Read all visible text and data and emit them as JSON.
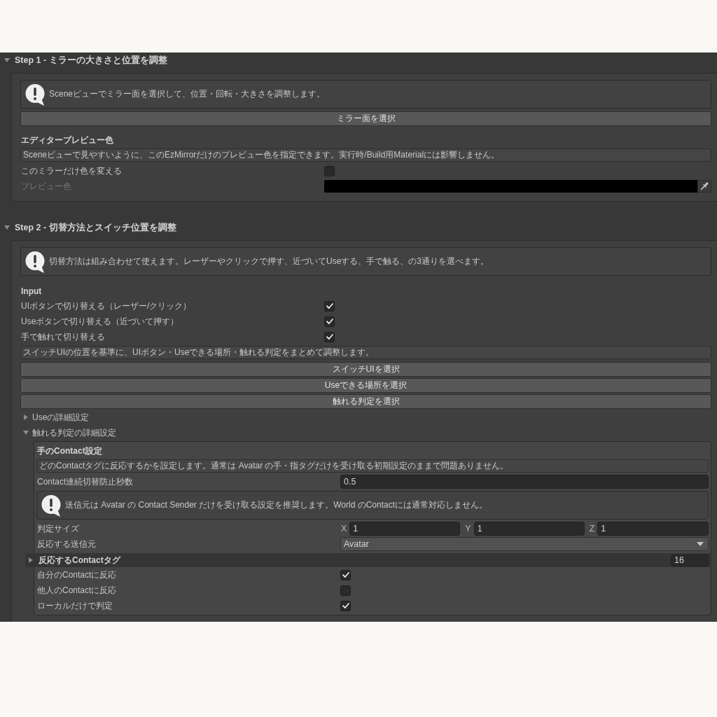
{
  "sections": [
    {
      "title": "Step 1 - ミラーの大きさと位置を調整",
      "expanded": true,
      "items": [
        {
          "kind": "help",
          "text": "Sceneビューでミラー面を選択して、位置・回転・大きさを調整します。"
        },
        {
          "kind": "button",
          "label": "ミラー面を選択"
        },
        {
          "kind": "heading",
          "text": "エディタープレビュー色"
        },
        {
          "kind": "note",
          "text": "Sceneビューで見やすいように、このEzMirrorだけのプレビュー色を指定できます。実行時/Build用Materialには影響しません。"
        },
        {
          "kind": "checkbox",
          "label": "このミラーだけ色を変える",
          "checked": false
        },
        {
          "kind": "color",
          "label": "プレビュー色",
          "disabled": true,
          "color": "#000000"
        }
      ]
    },
    {
      "title": "Step 2 - 切替方法とスイッチ位置を調整",
      "expanded": true,
      "items": [
        {
          "kind": "help",
          "text": "切替方法は組み合わせて使えます。レーザーやクリックで押す、近づいてUseする、手で触る、の3通りを選べます。"
        },
        {
          "kind": "heading",
          "text": "Input"
        },
        {
          "kind": "checkbox",
          "label": "UIボタンで切り替える（レーザー/クリック）",
          "checked": true
        },
        {
          "kind": "checkbox",
          "label": "Useボタンで切り替える（近づいて押す）",
          "checked": true
        },
        {
          "kind": "checkbox",
          "label": "手で触れて切り替える",
          "checked": true
        },
        {
          "kind": "note",
          "text": "スイッチUIの位置を基準に、UIボタン・Useできる場所・触れる判定をまとめて調整します。"
        },
        {
          "kind": "button",
          "label": "スイッチUIを選択"
        },
        {
          "kind": "button",
          "label": "Useできる場所を選択"
        },
        {
          "kind": "button",
          "label": "触れる判定を選択"
        },
        {
          "kind": "foldout",
          "label": "Useの詳細設定",
          "expanded": false
        },
        {
          "kind": "foldout",
          "label": "触れる判定の詳細設定",
          "expanded": true,
          "children": [
            {
              "kind": "heading",
              "text": "手のContact設定"
            },
            {
              "kind": "note",
              "text": "どのContactタグに反応するかを設定します。通常は Avatar の手・指タグだけを受け取る初期設定のままで問題ありません。"
            },
            {
              "kind": "number",
              "label": "Contact連続切替防止秒数",
              "value": "0.5"
            },
            {
              "kind": "help",
              "text": "送信元は Avatar の Contact Sender だけを受け取る設定を推奨します。World のContactには通常対応しません。"
            },
            {
              "kind": "vector",
              "label": "判定サイズ",
              "components": [
                {
                  "axis": "X",
                  "value": "1"
                },
                {
                  "axis": "Y",
                  "value": "1"
                },
                {
                  "axis": "Z",
                  "value": "1"
                }
              ]
            },
            {
              "kind": "dropdown",
              "label": "反応する送信元",
              "value": "Avatar"
            },
            {
              "kind": "list",
              "label": "反応するContactタグ",
              "expanded": false,
              "count": "16"
            },
            {
              "kind": "checkbox",
              "label": "自分のContactに反応",
              "checked": true
            },
            {
              "kind": "checkbox",
              "label": "他人のContactに反応",
              "checked": false
            },
            {
              "kind": "checkbox",
              "label": "ローカルだけで判定",
              "checked": true
            }
          ]
        }
      ]
    }
  ]
}
